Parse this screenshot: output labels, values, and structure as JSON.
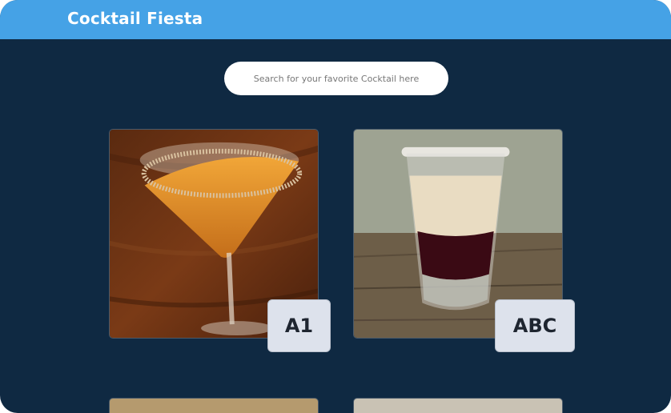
{
  "header": {
    "title": "Cocktail Fiesta"
  },
  "search": {
    "placeholder": "Search for your favorite Cocktail here",
    "value": ""
  },
  "cocktails": [
    {
      "name": "A1"
    },
    {
      "name": "ABC"
    }
  ],
  "colors": {
    "header": "#45a2e6",
    "background": "#0f2942",
    "badge": "#dde2ec"
  }
}
